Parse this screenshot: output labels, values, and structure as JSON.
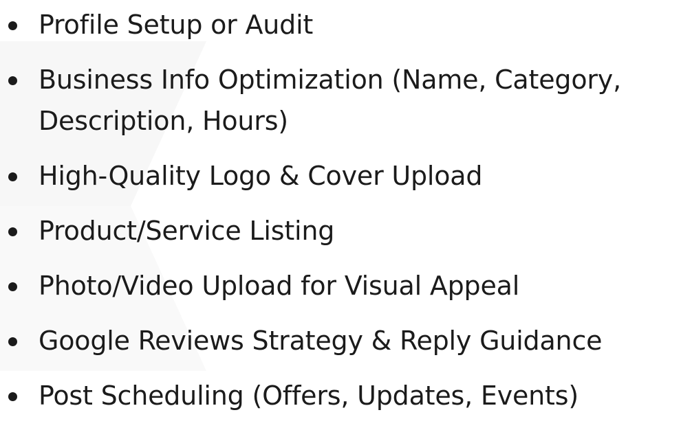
{
  "features": {
    "items": [
      "Profile Setup or Audit",
      "Business Info Optimization (Name, Category, Description, Hours)",
      "High-Quality Logo & Cover Upload",
      "Product/Service Listing",
      "Photo/Video Upload for Visual Appeal",
      "Google Reviews Strategy & Reply Guidance",
      "Post Scheduling (Offers, Updates, Events)"
    ]
  },
  "colors": {
    "text": "#1b1b1b",
    "background": "#ffffff"
  }
}
